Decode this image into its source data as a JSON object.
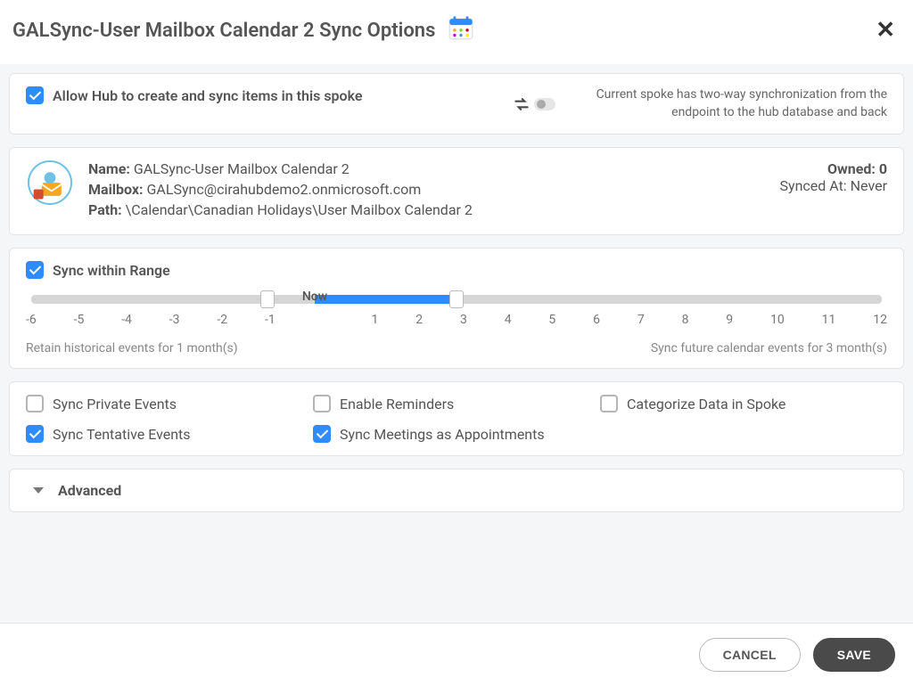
{
  "header": {
    "title": "GALSync-User Mailbox Calendar 2 Sync Options"
  },
  "allowHub": {
    "label": "Allow Hub to create and sync items in this spoke",
    "checked": true
  },
  "syncDescription": "Current spoke has two-way synchronization from the endpoint to the hub database and back",
  "info": {
    "nameLabel": "Name:",
    "nameValue": "GALSync-User Mailbox Calendar 2",
    "mailboxLabel": "Mailbox:",
    "mailboxValue": "GALSync@cirahubdemo2.onmicrosoft.com",
    "pathLabel": "Path:",
    "pathValue": "\\Calendar\\Canadian Holidays\\User Mailbox Calendar 2",
    "ownedLabel": "Owned:",
    "ownedValue": "0",
    "syncedLabel": "Synced At:",
    "syncedValue": "Never"
  },
  "range": {
    "title": "Sync within Range",
    "checked": true,
    "nowLabel": "Now",
    "min": -6,
    "max": 12,
    "pastHandle": -1,
    "futureHandle": 3,
    "ticks": [
      "-6",
      "-5",
      "-4",
      "-3",
      "-2",
      "-1",
      "1",
      "2",
      "3",
      "4",
      "5",
      "6",
      "7",
      "8",
      "9",
      "10",
      "11",
      "12"
    ],
    "retainText": "Retain historical events for 1 month(s)",
    "futureText": "Sync future calendar events for 3 month(s)"
  },
  "options": {
    "syncPrivate": {
      "label": "Sync Private Events",
      "checked": false
    },
    "enableReminders": {
      "label": "Enable Reminders",
      "checked": false
    },
    "categorize": {
      "label": "Categorize Data in Spoke",
      "checked": false
    },
    "syncTentative": {
      "label": "Sync Tentative Events",
      "checked": true
    },
    "syncMeetings": {
      "label": "Sync Meetings as Appointments",
      "checked": true
    }
  },
  "advanced": {
    "label": "Advanced"
  },
  "footer": {
    "cancel": "CANCEL",
    "save": "SAVE"
  }
}
